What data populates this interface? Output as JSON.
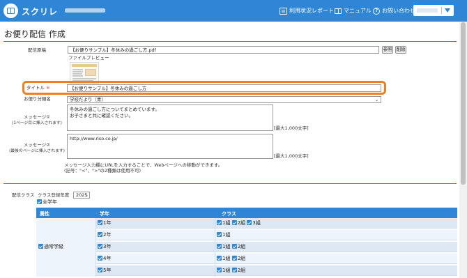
{
  "header": {
    "brand": "スクリレ",
    "links": [
      {
        "label": "利用状況レポート",
        "icon": "report-icon"
      },
      {
        "label": "マニュアル",
        "icon": "book-icon"
      },
      {
        "label": "お問い合わせ",
        "icon": "help-icon"
      }
    ],
    "accent_color": "#2f86d6"
  },
  "page": {
    "title": "お便り配信 作成"
  },
  "form": {
    "source_label": "配信原稿",
    "source_file": "【お便りサンプル】冬休みの過ごし方.pdf",
    "browse_button": "参照",
    "delete_button": "削除",
    "preview_label": "ファイルプレビュー",
    "title_label": "タイトル",
    "required_mark": "※",
    "title_value": "【お便りサンプル】冬休みの過ごし方",
    "category_label": "お便り分類名",
    "category_value": "学校だより（青）",
    "message1_label_line1": "メッセージ①",
    "message1_label_line2": "(1ページ目に挿入されます)",
    "message1_value_line1": "冬休みの過ごし方についてまとめています。",
    "message1_value_line2": "お子さまと共に確認ください。",
    "message1_limit": "[最大1,000文字]",
    "message2_label_line1": "メッセージ②",
    "message2_label_line2": "(最後のページに挿入されます)",
    "message2_value": "http://www.riso.co.jp/",
    "message2_limit": "[最大1,000文字]",
    "url_note_line1": "メッセージ入力欄にURLを入力することで、Webページへの移動ができます。",
    "url_note_line2": "(記号：\"<\"、\">\"の2種類は使用不可)"
  },
  "classes": {
    "label": "配信クラス",
    "year_label": "クラス登録年度",
    "year_value": "2025",
    "all_grades_label": "全学年",
    "table": {
      "headers": [
        "属性",
        "学年",
        "クラス"
      ],
      "attribute": "通常学級",
      "rows": [
        {
          "grade": "1年",
          "classes": [
            "1組",
            "2組",
            "3組"
          ]
        },
        {
          "grade": "2年",
          "classes": [
            "1組"
          ]
        },
        {
          "grade": "3年",
          "classes": [
            "1組",
            "2組"
          ]
        },
        {
          "grade": "4年",
          "classes": [
            "1組",
            "2組"
          ]
        },
        {
          "grade": "5年",
          "classes": [
            "1組",
            "2組"
          ]
        }
      ]
    }
  },
  "highlight_color": "#f07f22"
}
